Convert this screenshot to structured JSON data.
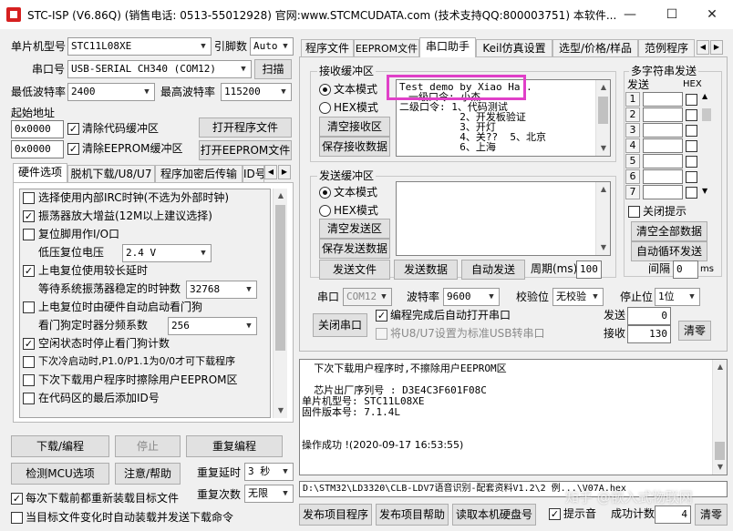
{
  "window": {
    "title": "STC-ISP (V6.86Q) (销售电话: 0513-55012928) 官网:www.STCMCUDATA.com  (技术支持QQ:800003751) 本软件...",
    "minimize": "—",
    "maximize": "☐",
    "close": "✕"
  },
  "left": {
    "mcu_label": "单片机型号",
    "mcu_value": "STC11L08XE",
    "pins_label": "引脚数",
    "pins_value": "Auto",
    "port_label": "串口号",
    "port_value": "USB-SERIAL CH340 (COM12)",
    "scan_btn": "扫描",
    "min_baud_label": "最低波特率",
    "min_baud_value": "2400",
    "max_baud_label": "最高波特率",
    "max_baud_value": "115200",
    "start_addr_label": "起始地址",
    "addr1": "0x0000",
    "clear_code_label": "清除代码缓冲区",
    "open_prog_btn": "打开程序文件",
    "addr2": "0x0000",
    "clear_eeprom_label": "清除EEPROM缓冲区",
    "open_eeprom_btn": "打开EEPROM文件",
    "tabs": [
      "硬件选项",
      "脱机下载/U8/U7",
      "程序加密后传输",
      "ID号"
    ],
    "options": {
      "opt1": "选择使用内部IRC时钟(不选为外部时钟)",
      "opt2": "振荡器放大增益(12M以上建议选择)",
      "opt3": "复位脚用作I/O口",
      "low_volt_label": "低压复位电压",
      "low_volt_value": "2.4 V",
      "opt4": "上电复位使用较长延时",
      "osc_wait_label": "等待系统振荡器稳定的时钟数",
      "osc_wait_value": "32768",
      "opt5": "上电复位时由硬件自动启动看门狗",
      "wdt_div_label": "看门狗定时器分频系数",
      "wdt_div_value": "256",
      "opt6": "空闲状态时停止看门狗计数",
      "opt7": "下次冷启动时,P1.0/P1.1为0/0才可下载程序",
      "opt8": "下次下载用户程序时擦除用户EEPROM区",
      "opt9": "在代码区的最后添加ID号"
    },
    "download_btn": "下载/编程",
    "stop_btn": "停止",
    "reprogram_btn": "重复编程",
    "detect_btn": "检测MCU选项",
    "help_btn": "注意/帮助",
    "repeat_delay_label": "重复延时",
    "repeat_delay_value": "3 秒",
    "repeat_count_label": "重复次数",
    "repeat_count_value": "无限",
    "reload_check_label": "每次下载前都重新装载目标文件",
    "auto_load_label": "当目标文件变化时自动装载并发送下载命令"
  },
  "right": {
    "tabs": [
      "程序文件",
      "EEPROM文件",
      "串口助手",
      "Keil仿真设置",
      "选型/价格/样品",
      "范例程序"
    ],
    "rx_group": "接收缓冲区",
    "text_mode": "文本模式",
    "hex_mode": "HEX模式",
    "clear_rx_btn": "清空接收区",
    "save_rx_btn": "保存接收数据",
    "rx_lines": [
      "Test demo by Xiao Ha .",
      "一级口令: 小杰",
      "二级口令: 1、代码测试",
      "          2、开发板验证",
      "          3、开灯",
      "          4、关??  5、北京",
      "          6、上海"
    ],
    "tx_group": "发送缓冲区",
    "tx_text_mode": "文本模式",
    "tx_hex_mode": "HEX模式",
    "clear_tx_btn": "清空发送区",
    "save_tx_btn": "保存发送数据",
    "send_file_btn": "发送文件",
    "send_data_btn": "发送数据",
    "auto_send_btn": "自动发送",
    "period_label": "周期(ms)",
    "period_value": "100",
    "multi_group": "多字符串发送",
    "send_col": "发送",
    "hex_col": "HEX",
    "rows": [
      "1",
      "2",
      "3",
      "4",
      "5",
      "6",
      "7"
    ],
    "close_prompt": "关闭提示",
    "clear_all_btn": "清空全部数据",
    "auto_loop_btn": "自动循环发送",
    "interval_label": "间隔",
    "interval_value": "0",
    "interval_unit": "ms",
    "serial_label": "串口",
    "serial_value": "COM12",
    "baud_label": "波特率",
    "baud_value": "9600",
    "parity_label": "校验位",
    "parity_value": "无校验",
    "stop_label": "停止位",
    "stop_value": "1位",
    "close_port_btn": "关闭串口",
    "auto_open_label": "编程完成后自动打开串口",
    "u8_label": "将U8/U7设置为标准USB转串口",
    "tx_count_label": "发送",
    "tx_count_value": "0",
    "rx_count_label": "接收",
    "rx_count_value": "130",
    "clear_count_btn": "清零",
    "log_lines": [
      "  下次下载用户程序时,不擦除用户EEPROM区",
      "",
      "  芯片出厂序列号 : D3E4C3F601F08C",
      "单片机型号: STC11L08XE",
      "固件版本号: 7.1.4L",
      "",
      "",
      "操作成功 !(2020-09-17 16:53:55)"
    ],
    "path_value": "D:\\STM32\\LD3320\\CLB-LDV7语音识别-配套资料V1.2\\2 例...\\V07A.hex",
    "publish_prog_btn": "发布项目程序",
    "publish_help_btn": "发布项目帮助",
    "read_disk_btn": "读取本机硬盘号",
    "beep_label": "提示音",
    "success_count_label": "成功计数",
    "success_count_value": "4",
    "clear_success_btn": "清零"
  },
  "watermark": "知乎 @嵌入式物联网",
  "colors": {
    "highlight_box": "#e040c8",
    "window_bg": "#f0f0f0"
  }
}
